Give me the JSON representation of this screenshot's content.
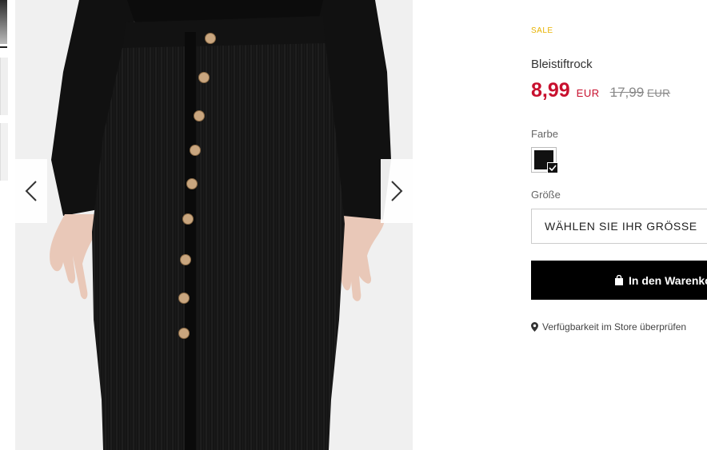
{
  "product": {
    "badge": "SALE",
    "name": "Bleistiftrock",
    "price": "8,99",
    "currency": "EUR",
    "old_price": "17,99",
    "old_currency": "EUR"
  },
  "options": {
    "color_label": "Farbe",
    "selected_color": "#111111",
    "size_label": "Größe",
    "size_placeholder": "WÄHLEN SIE IHR GRÖSSE"
  },
  "actions": {
    "add_to_cart": "In den Warenkorb",
    "store_availability": "Verfügbarkeit im Store überprüfen"
  },
  "gallery": {
    "prev_icon": "chevron-left-icon",
    "next_icon": "chevron-right-icon"
  }
}
